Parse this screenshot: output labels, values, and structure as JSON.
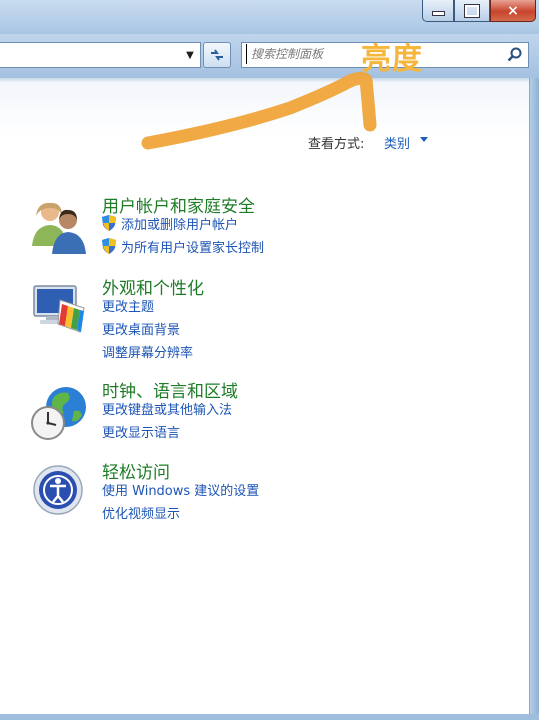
{
  "window": {
    "minimize_label": "",
    "maximize_label": "",
    "close_label": "×"
  },
  "toolbar": {
    "address_value": "",
    "search_placeholder": "搜索控制面板"
  },
  "annotation": {
    "text": "亮度",
    "color": "#f5b63b"
  },
  "view": {
    "label": "查看方式:",
    "value": "类别"
  },
  "categories": [
    {
      "title": "用户帐户和家庭安全",
      "icon": "users-icon",
      "links": [
        "添加或删除用户帐户",
        "为所有用户设置家长控制"
      ]
    },
    {
      "title": "外观和个性化",
      "icon": "appearance-icon",
      "links": [
        "更改主题",
        "更改桌面背景",
        "调整屏幕分辨率"
      ]
    },
    {
      "title": "时钟、语言和区域",
      "icon": "clock-globe-icon",
      "links": [
        "更改键盘或其他输入法",
        "更改显示语言"
      ]
    },
    {
      "title": "轻松访问",
      "icon": "ease-of-access-icon",
      "links": [
        "使用 Windows 建议的设置",
        "优化视频显示"
      ]
    }
  ],
  "colors": {
    "category_title": "#1e7c26",
    "link": "#1d55b4",
    "close_button": "#c7442d"
  }
}
